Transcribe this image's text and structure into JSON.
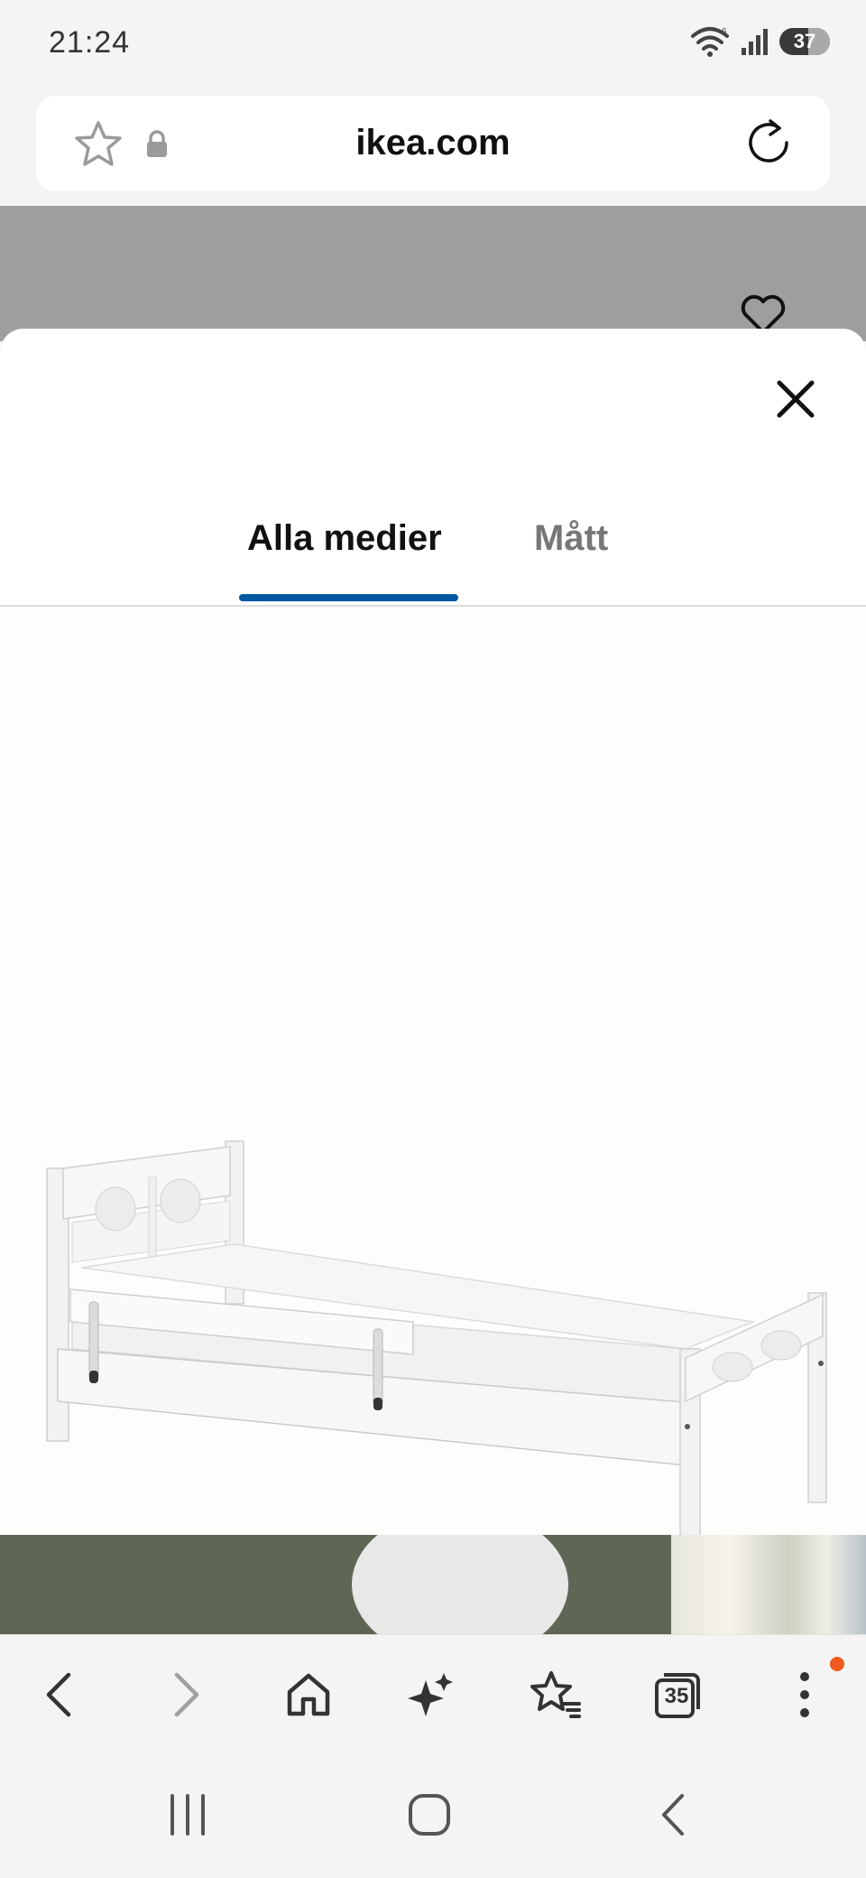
{
  "status_bar": {
    "time": "21:24",
    "battery_level": "37",
    "icons": [
      "wifi-icon",
      "signal-icon",
      "battery-icon"
    ]
  },
  "url_bar": {
    "url": "ikea.com",
    "icons": [
      "star-icon",
      "lock-icon",
      "reload-icon"
    ]
  },
  "modal": {
    "tabs": [
      {
        "label": "Alla medier",
        "active": true
      },
      {
        "label": "Mått",
        "active": false
      }
    ],
    "accent_color": "#0058a3",
    "image_subject": "white children's bed with safety rail"
  },
  "toolbar": {
    "tabs_count": "35",
    "notification_color": "#f05a1e"
  }
}
